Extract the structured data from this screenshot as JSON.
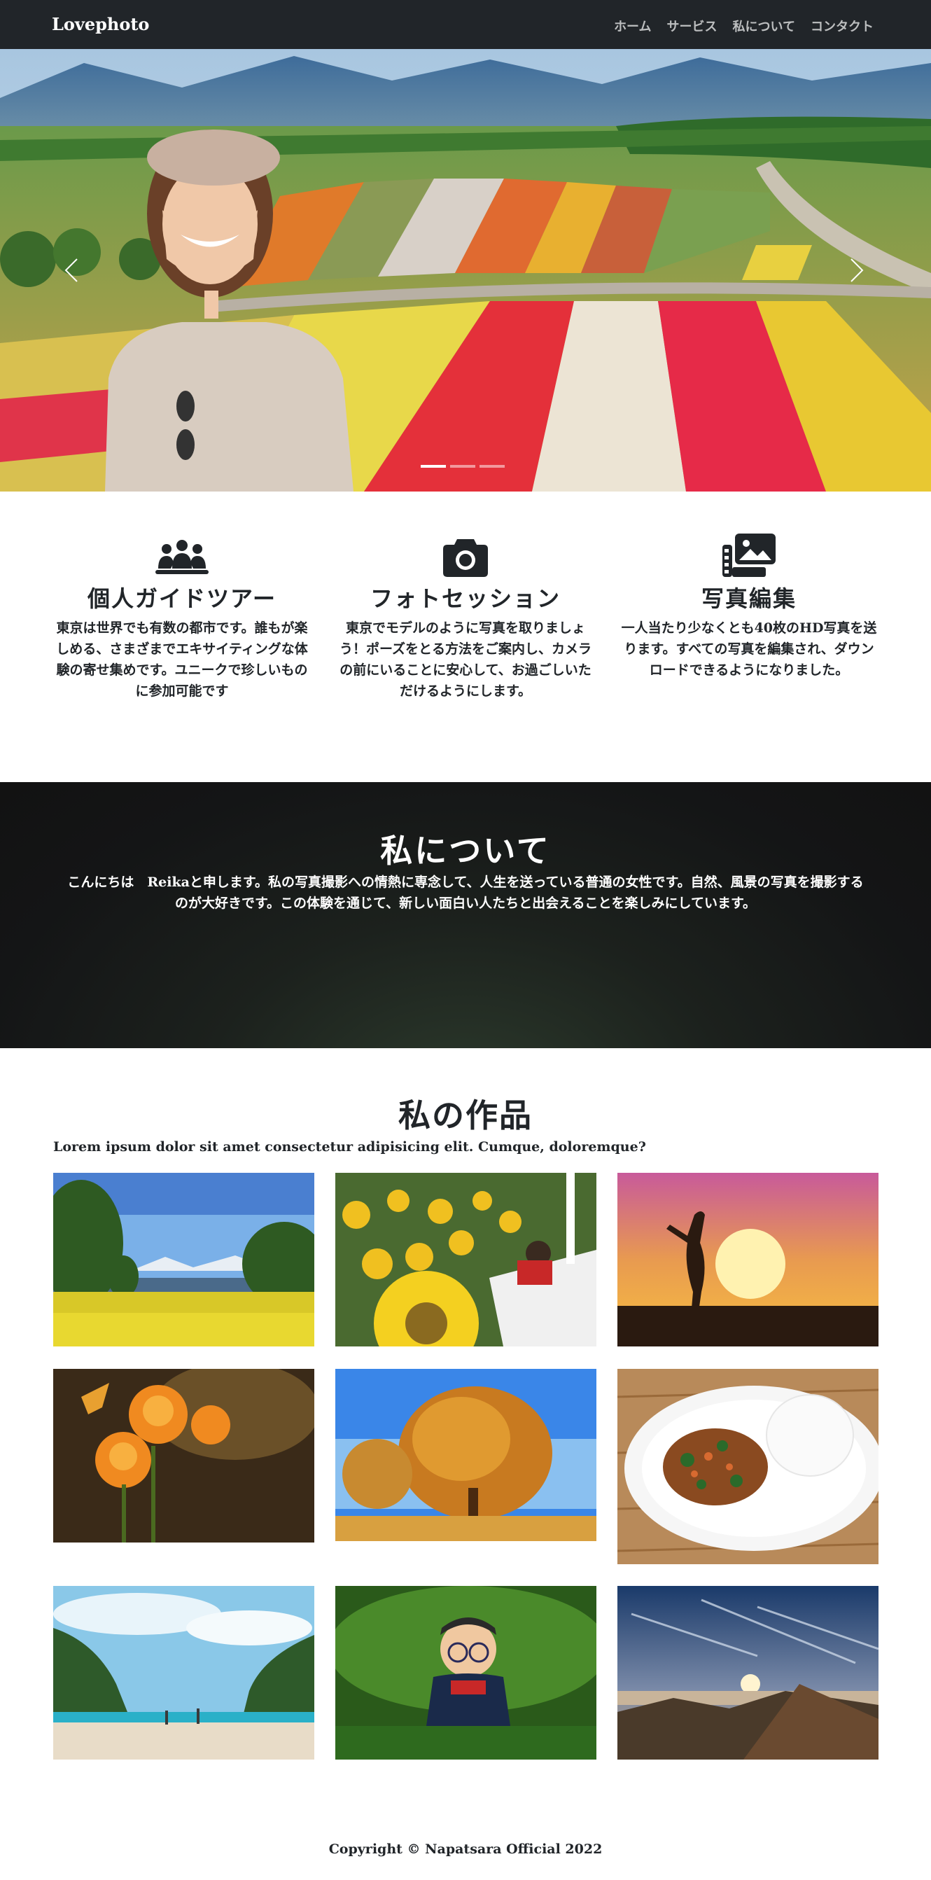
{
  "navbar": {
    "brand": "Lovephoto",
    "links": [
      "ホーム",
      "サービス",
      "私について",
      "コンタクト"
    ]
  },
  "hero": {
    "slide_count": 3,
    "active_slide": 1
  },
  "services": [
    {
      "title": "個人ガイドツアー",
      "text": "東京は世界でも有数の都市です。誰もが楽しめる、さまざまでエキサイティングな体験の寄せ集めです。ユニークで珍しいものに参加可能です",
      "icon": "people-group-icon"
    },
    {
      "title": "フォトセッション",
      "text": "東京でモデルのように写真を取りましょう！ポーズをとる方法をご案内し、カメラの前にいることに安心して、お過ごしいただけるようにします。",
      "icon": "camera-icon"
    },
    {
      "title": "写真編集",
      "text": "一人当たり少なくとも40枚のHD写真を送ります。すべての写真を編集され、ダウンロードできるようになりました。",
      "icon": "photo-film-icon"
    }
  ],
  "about": {
    "title": "私について",
    "text": "こんにちは　Reikaと申します。私の写真撮影への情熱に専念して、人生を送っている普通の女性です。自然、風景の写真を撮影するのが大好きです。この体験を通じて、新しい面白い人たちと出会えることを楽しみにしています。"
  },
  "works": {
    "title": "私の作品",
    "lead": "Lorem ipsum dolor sit amet consectetur adipisicing elit. Cumque, doloremque?"
  },
  "footer": {
    "copyright": "Copyright © Napatsara Official 2022"
  },
  "colors": {
    "navbar_bg": "#212529",
    "text": "#212529",
    "about_bg": "#141516"
  }
}
